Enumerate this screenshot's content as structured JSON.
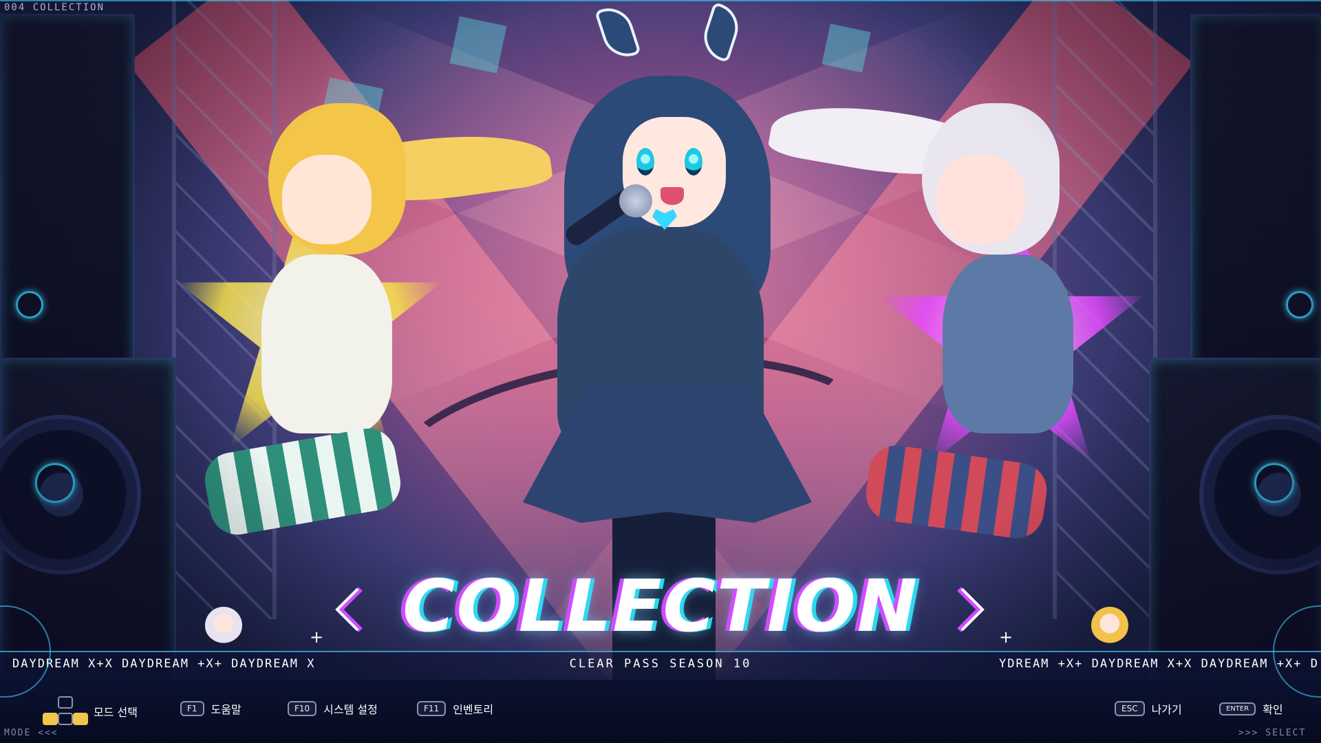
{
  "hud": {
    "top_tag": "004 COLLECTION",
    "title": "COLLECTION",
    "subtitle": "CLEAR PASS SEASON 10",
    "ticker_left": "DAYDREAM X+X DAYDREAM +X+ DAYDREAM X",
    "ticker_right": "YDREAM +X+ DAYDREAM X+X DAYDREAM +X+ D",
    "mode_label": "MODE <<<",
    "select_label": ">>> SELECT"
  },
  "controls": {
    "mode_select": {
      "label": "모드 선택"
    },
    "help": {
      "key": "F1",
      "label": "도움말"
    },
    "system": {
      "key": "F10",
      "label": "시스템 설정"
    },
    "inventory": {
      "key": "F11",
      "label": "인벤토리"
    },
    "exit": {
      "key": "ESC",
      "label": "나가기"
    },
    "confirm": {
      "key": "ENTER",
      "label": "확인"
    }
  },
  "icons": {
    "prev": "chevron-left-icon",
    "next": "chevron-right-icon",
    "dpad": "dpad-icon"
  },
  "colors": {
    "accent_cyan": "#2fd8f0",
    "accent_magenta": "#d04cff",
    "background": "#1a1030"
  }
}
